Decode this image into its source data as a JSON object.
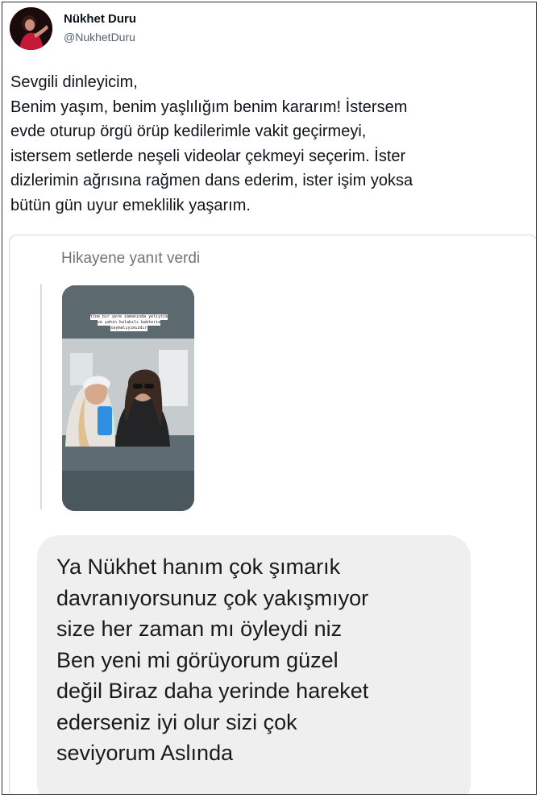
{
  "tweet": {
    "author_name": "Nükhet Duru",
    "author_handle": "@NukhetDuru",
    "text_lines": [
      "Sevgili dinleyicim,",
      "Benim yaşım, benim yaşlılığım benim kararım! İstersem",
      "evde oturup örgü örüp kedilerimle vakit geçirmeyi,",
      "istersem setlerde neşeli videolar çekmeyi seçerim. İster",
      "dizlerimin ağrısına rağmen dans ederim, ister işim yoksa",
      "bütün gün uyur emeklilik yaşarım."
    ]
  },
  "story_reply": {
    "header": "Hikayene yanıt verdi",
    "story_caption_lines": [
      "Yine bir yere zamanında yetiştik",
      "ve şahin kalabılı bakteria",
      "saymalıyımızdır"
    ],
    "message_lines": [
      "Ya Nükhet hanım çok şımarık",
      "davranıyorsunuz çok yakışmıyor",
      "size her zaman mı öyleydi niz",
      "Ben yeni mi görüyorum güzel",
      "değil Biraz daha yerinde hareket",
      "ederseniz iyi olur sizi çok",
      "seviyorum Aslında"
    ]
  },
  "colors": {
    "text_primary": "#0f1419",
    "text_secondary": "#536471",
    "bubble_bg": "#efefef",
    "story_header": "#737373"
  }
}
